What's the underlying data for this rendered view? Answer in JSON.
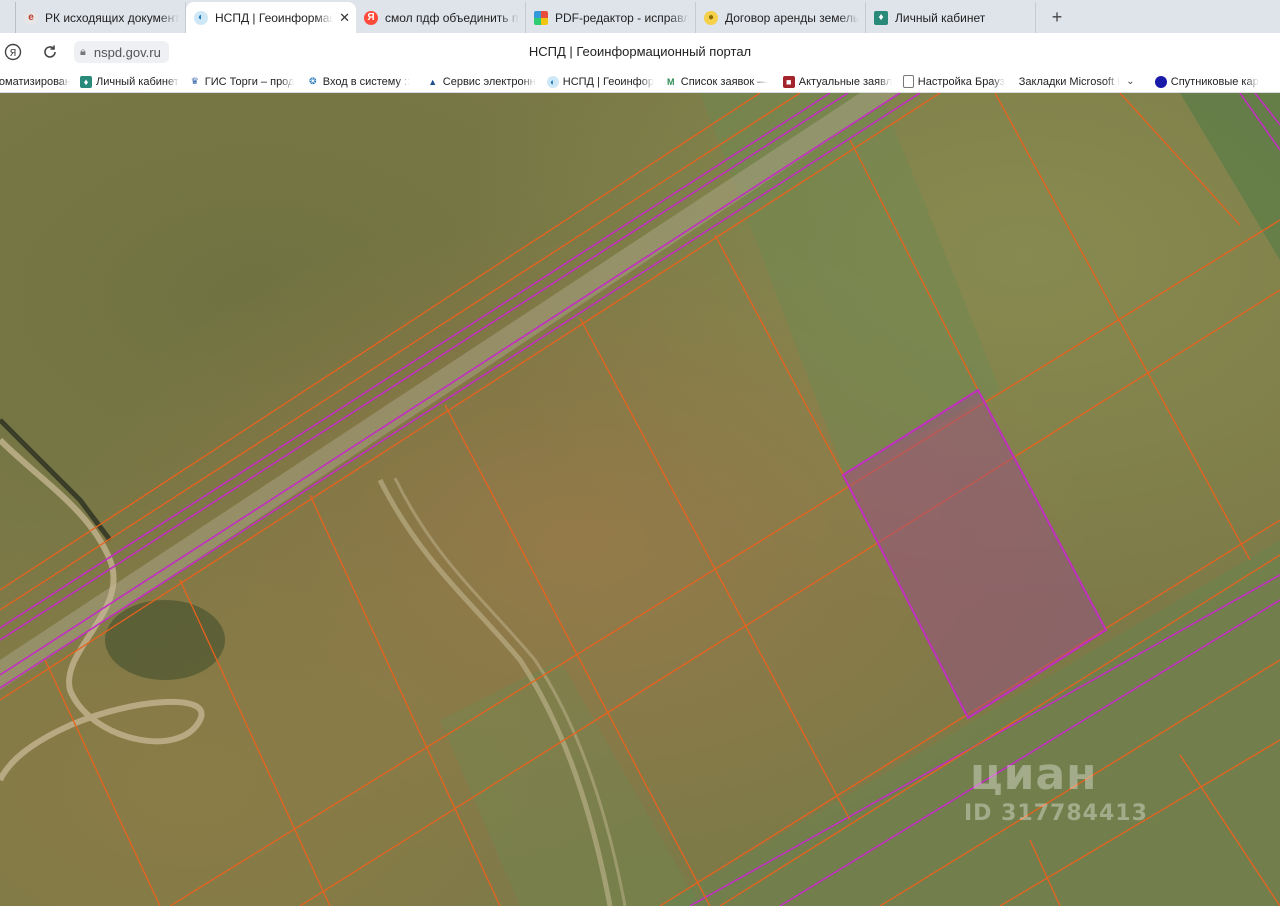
{
  "tabs": [
    {
      "label": "РК исходящих документо",
      "icon": "doc-icon",
      "active": false
    },
    {
      "label": "НСПД | Геоинформаци",
      "icon": "nspd-icon",
      "active": true
    },
    {
      "label": "смол пдф объединить пдф",
      "icon": "yandex-icon",
      "active": false
    },
    {
      "label": "PDF-редактор - исправле",
      "icon": "pdf-icon",
      "active": false
    },
    {
      "label": "Договор аренды земельн",
      "icon": "bulb-icon",
      "active": false
    },
    {
      "label": "Личный кабинет",
      "icon": "shield-icon",
      "active": false
    }
  ],
  "address_bar": {
    "url": "nspd.gov.ru",
    "page_title": "НСПД | Геоинформационный портал"
  },
  "bookmarks": [
    {
      "label": "томатизирован",
      "icon": "none"
    },
    {
      "label": "Личный кабинет",
      "icon": "shield-icon"
    },
    {
      "label": "ГИС Торги – прод",
      "icon": "emblem-icon"
    },
    {
      "label": "Вход в систему :: ",
      "icon": "globe-icon"
    },
    {
      "label": "Сервис электронн",
      "icon": "mountain-icon"
    },
    {
      "label": "НСПД | Геоинфор",
      "icon": "nspd-icon"
    },
    {
      "label": "Список заявок —",
      "icon": "m-icon"
    },
    {
      "label": "Актуальные заявл",
      "icon": "cube-icon"
    },
    {
      "label": "Настройка Брауз",
      "icon": "page-icon"
    },
    {
      "label": "Закладки Microsoft I",
      "icon": "none"
    },
    {
      "label": "Спутниковые кар",
      "icon": "dot-icon"
    }
  ],
  "map": {
    "watermark_brand": "циан",
    "watermark_id": "ID 317784413"
  },
  "colors": {
    "parcel_line": "#e8621e",
    "boundary_line": "#c12fc1",
    "selected_fill": "#9b4a8c"
  }
}
